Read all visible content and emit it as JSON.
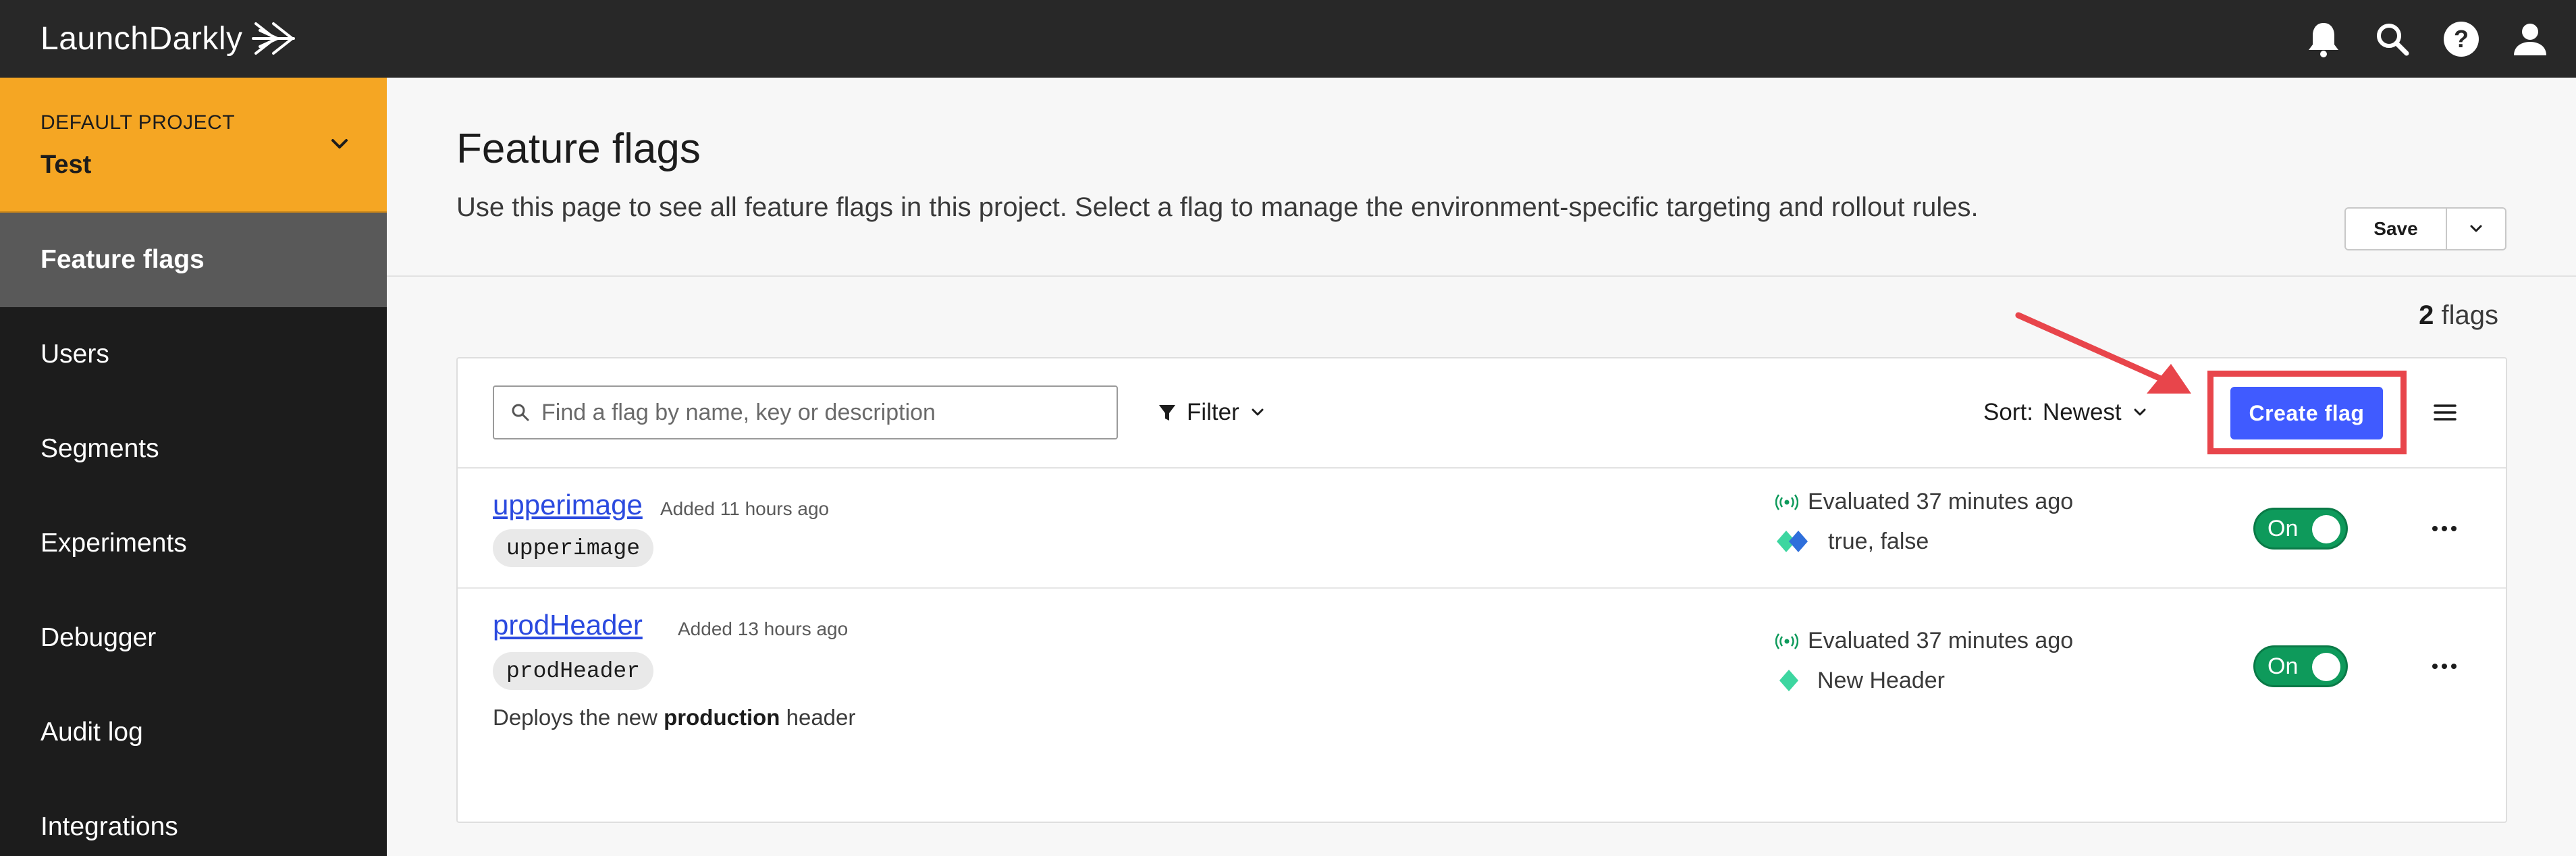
{
  "app": {
    "logo_text": "LaunchDarkly"
  },
  "topbar": {
    "icons": [
      "bell-icon",
      "search-icon",
      "help-icon",
      "user-icon"
    ]
  },
  "sidebar": {
    "project_label": "DEFAULT PROJECT",
    "project_name": "Test",
    "items": [
      {
        "label": "Feature flags",
        "active": true
      },
      {
        "label": "Users"
      },
      {
        "label": "Segments"
      },
      {
        "label": "Experiments"
      },
      {
        "label": "Debugger"
      },
      {
        "label": "Audit log"
      },
      {
        "label": "Integrations"
      }
    ]
  },
  "header": {
    "title": "Feature flags",
    "description": "Use this page to see all feature flags in this project. Select a flag to manage the environment-specific targeting and rollout rules.",
    "save_label": "Save"
  },
  "summary": {
    "count": "2",
    "count_label": "flags"
  },
  "toolbar": {
    "search_placeholder": "Find a flag by name, key or description",
    "search_value": "",
    "filter_label": "Filter",
    "sort_label": "Sort:",
    "sort_value": "Newest",
    "create_label": "Create flag"
  },
  "flags": [
    {
      "name": "upperimage",
      "added": "Added 11 hours ago",
      "key": "upperimage",
      "description": "",
      "evaluated": "Evaluated 37 minutes ago",
      "variations": "true, false",
      "toggle": "On"
    },
    {
      "name": "prodHeader",
      "added": "Added 13 hours ago",
      "key": "prodHeader",
      "description_prefix": "Deploys the new ",
      "description_bold": "production",
      "description_suffix": " header",
      "evaluated": "Evaluated 37 minutes ago",
      "variations": "New Header",
      "toggle": "On"
    }
  ],
  "colors": {
    "accent": "#405bff",
    "project_bg": "#f5a623",
    "toggle_on": "#0e9a5b",
    "highlight": "#e8454b"
  }
}
